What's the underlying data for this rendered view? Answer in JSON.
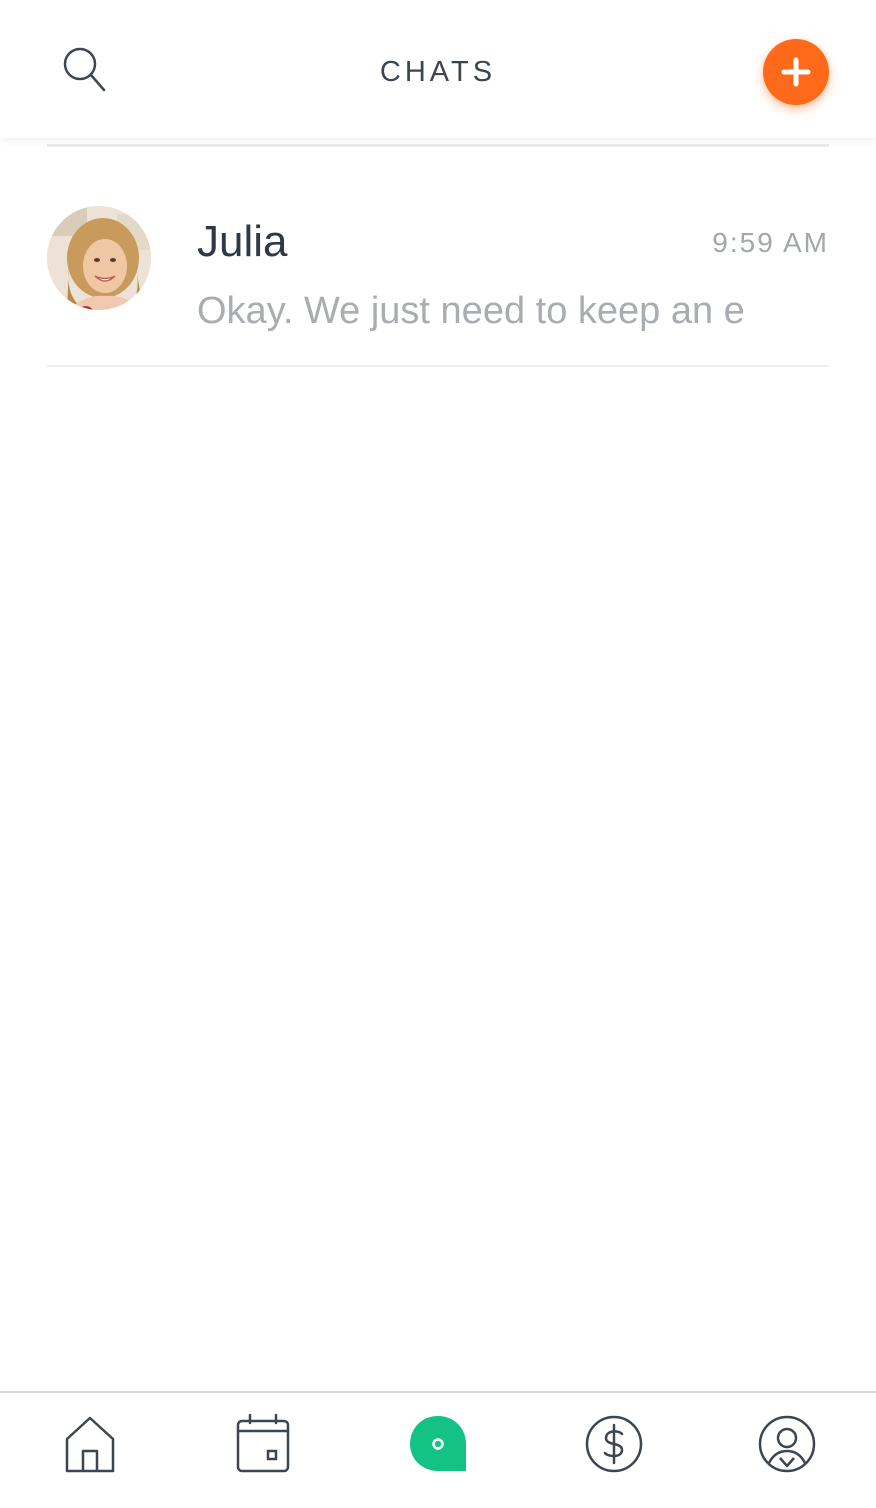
{
  "header": {
    "title": "CHATS",
    "search_icon": "search-icon",
    "add_icon": "plus-icon"
  },
  "chats": [
    {
      "name": "Julia",
      "time": "9:59 AM",
      "preview": "Okay. We just need to keep an e"
    }
  ],
  "bottom_nav": {
    "items": [
      {
        "icon": "home-icon",
        "active": false
      },
      {
        "icon": "calendar-icon",
        "active": false
      },
      {
        "icon": "chat-bubble-icon",
        "active": true
      },
      {
        "icon": "dollar-icon",
        "active": false
      },
      {
        "icon": "profile-icon",
        "active": false
      }
    ]
  },
  "colors": {
    "accent_orange": "#ff6a1a",
    "active_green": "#15c286",
    "text_dark": "#2f3a44",
    "text_muted": "#a9adb2",
    "icon_stroke": "#3c4650"
  }
}
